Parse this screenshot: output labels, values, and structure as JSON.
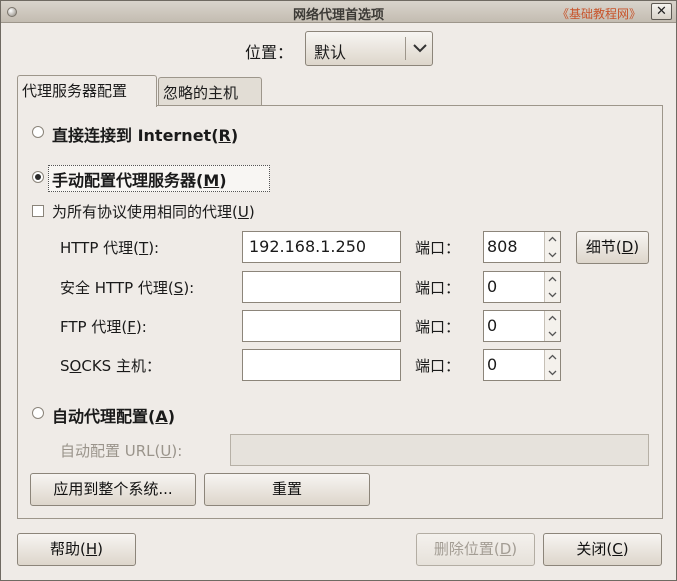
{
  "window": {
    "title": "网络代理首选项",
    "watermark": "《基础教程网》",
    "close_glyph": "✕"
  },
  "location": {
    "label": "位置：",
    "value": "默认"
  },
  "tabs": [
    {
      "label": "代理服务器配置",
      "active": true
    },
    {
      "label": "忽略的主机",
      "active": false
    }
  ],
  "direct": {
    "label_pre": "直接连接到 Internet(",
    "key": "R",
    "label_post": ")",
    "selected": false
  },
  "manual": {
    "label_pre": "手动配置代理服务器(",
    "key": "M",
    "label_post": ")",
    "selected": true
  },
  "same_proxy": {
    "label_pre": "为所有协议使用相同的代理(",
    "key": "U",
    "label_post": ")",
    "checked": false
  },
  "proxies": [
    {
      "label_pre": "HTTP 代理(",
      "key": "T",
      "label_post": "):",
      "value": "192.168.1.250",
      "port_label": "端口：",
      "port": "808"
    },
    {
      "label_pre": "安全 HTTP 代理(",
      "key": "S",
      "label_post": "):",
      "value": "",
      "port_label": "端口：",
      "port": "0"
    },
    {
      "label_pre": "FTP 代理(",
      "key": "F",
      "label_post": "):",
      "value": "",
      "port_label": "端口：",
      "port": "0"
    },
    {
      "label_pre": "S",
      "key": "O",
      "label_post": "CKS 主机：",
      "value": "",
      "port_label": "端口：",
      "port": "0"
    }
  ],
  "details_button": {
    "label_pre": "细节(",
    "key": "D",
    "label_post": ")"
  },
  "auto": {
    "label_pre": "自动代理配置(",
    "key": "A",
    "label_post": ")",
    "selected": false,
    "url_label_pre": "自动配置 URL(",
    "url_key": "U",
    "url_label_post": "):",
    "url_value": ""
  },
  "apply_button": {
    "label": "应用到整个系统..."
  },
  "reset_button": {
    "label": "重置"
  },
  "help_button": {
    "label_pre": "帮助(",
    "key": "H",
    "label_post": ")"
  },
  "delete_location_button": {
    "label_pre": "删除位置(",
    "key": "D",
    "label_post": ")",
    "disabled": true
  },
  "close_button": {
    "label_pre": "关闭(",
    "key": "C",
    "label_post": ")"
  }
}
